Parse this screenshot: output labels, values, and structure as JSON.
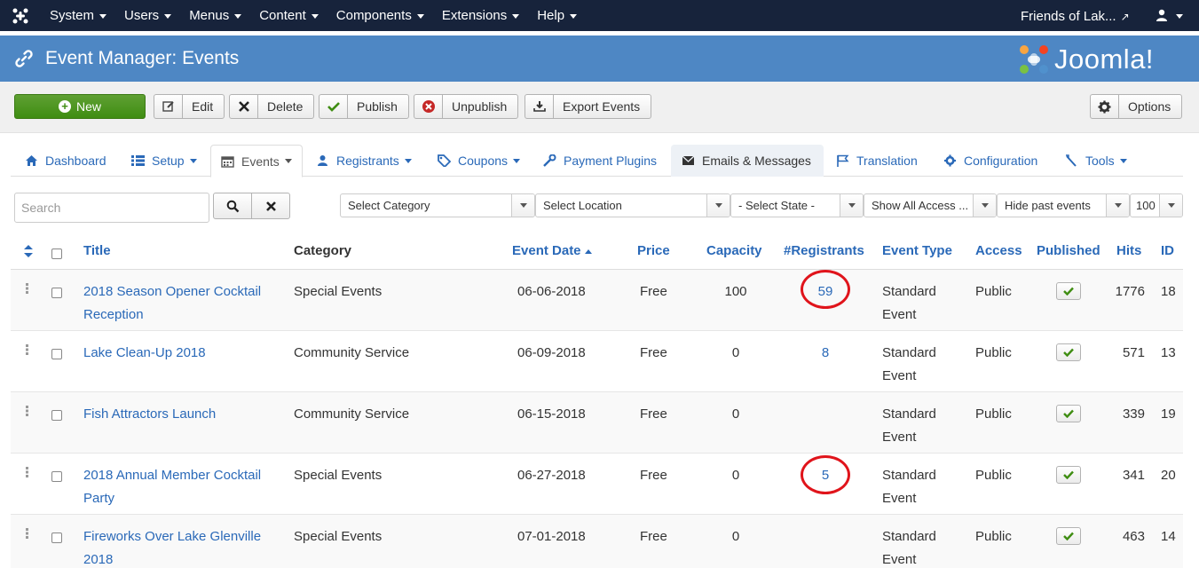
{
  "topnav": {
    "menu": [
      "System",
      "Users",
      "Menus",
      "Content",
      "Components",
      "Extensions",
      "Help"
    ],
    "site_name": "Friends of Lak...",
    "logo_icon": "joomla-logo-icon",
    "user_icon": "user-icon"
  },
  "header": {
    "title": "Event Manager: Events",
    "brand": "Joomla!"
  },
  "toolbar": {
    "new": "New",
    "edit": "Edit",
    "delete": "Delete",
    "publish": "Publish",
    "unpublish": "Unpublish",
    "export": "Export Events",
    "options": "Options"
  },
  "tabs": [
    "Dashboard",
    "Setup",
    "Events",
    "Registrants",
    "Coupons",
    "Payment Plugins",
    "Emails & Messages",
    "Translation",
    "Configuration",
    "Tools"
  ],
  "filters": {
    "search_placeholder": "Search",
    "category": "Select Category",
    "location": "Select Location",
    "state": "- Select State -",
    "access": "Show All Access ...",
    "past": "Hide past events",
    "limit": "100"
  },
  "table": {
    "headers": {
      "title": "Title",
      "category": "Category",
      "event_date": "Event Date",
      "price": "Price",
      "capacity": "Capacity",
      "registrants": "#Registrants",
      "event_type": "Event Type",
      "access": "Access",
      "published": "Published",
      "hits": "Hits",
      "id": "ID"
    },
    "rows": [
      {
        "title_1": "2018 Season Opener Cocktail",
        "title_2": "Reception",
        "category": "Special Events",
        "date": "06-06-2018",
        "price": "Free",
        "capacity": "100",
        "registrants": "59",
        "type_1": "Standard",
        "type_2": "Event",
        "access": "Public",
        "hits": "1776",
        "id": "18"
      },
      {
        "title_1": "Lake Clean-Up 2018",
        "title_2": "",
        "category": "Community Service",
        "date": "06-09-2018",
        "price": "Free",
        "capacity": "0",
        "registrants": "8",
        "type_1": "Standard",
        "type_2": "Event",
        "access": "Public",
        "hits": "571",
        "id": "13"
      },
      {
        "title_1": "Fish Attractors Launch",
        "title_2": "",
        "category": "Community Service",
        "date": "06-15-2018",
        "price": "Free",
        "capacity": "0",
        "registrants": "",
        "type_1": "Standard",
        "type_2": "Event",
        "access": "Public",
        "hits": "339",
        "id": "19"
      },
      {
        "title_1": "2018 Annual Member Cocktail",
        "title_2": "Party",
        "category": "Special Events",
        "date": "06-27-2018",
        "price": "Free",
        "capacity": "0",
        "registrants": "5",
        "type_1": "Standard",
        "type_2": "Event",
        "access": "Public",
        "hits": "341",
        "id": "20"
      },
      {
        "title_1": "Fireworks Over Lake Glenville",
        "title_2": "2018",
        "category": "Special Events",
        "date": "07-01-2018",
        "price": "Free",
        "capacity": "0",
        "registrants": "",
        "type_1": "Standard",
        "type_2": "Event",
        "access": "Public",
        "hits": "463",
        "id": "14"
      }
    ]
  },
  "colors": {
    "topnav_bg": "#17233b",
    "header_bg": "#4e87c4",
    "new_button": "#3f8d12",
    "link": "#2a69b8",
    "annotation_circle": "#e0141b"
  }
}
